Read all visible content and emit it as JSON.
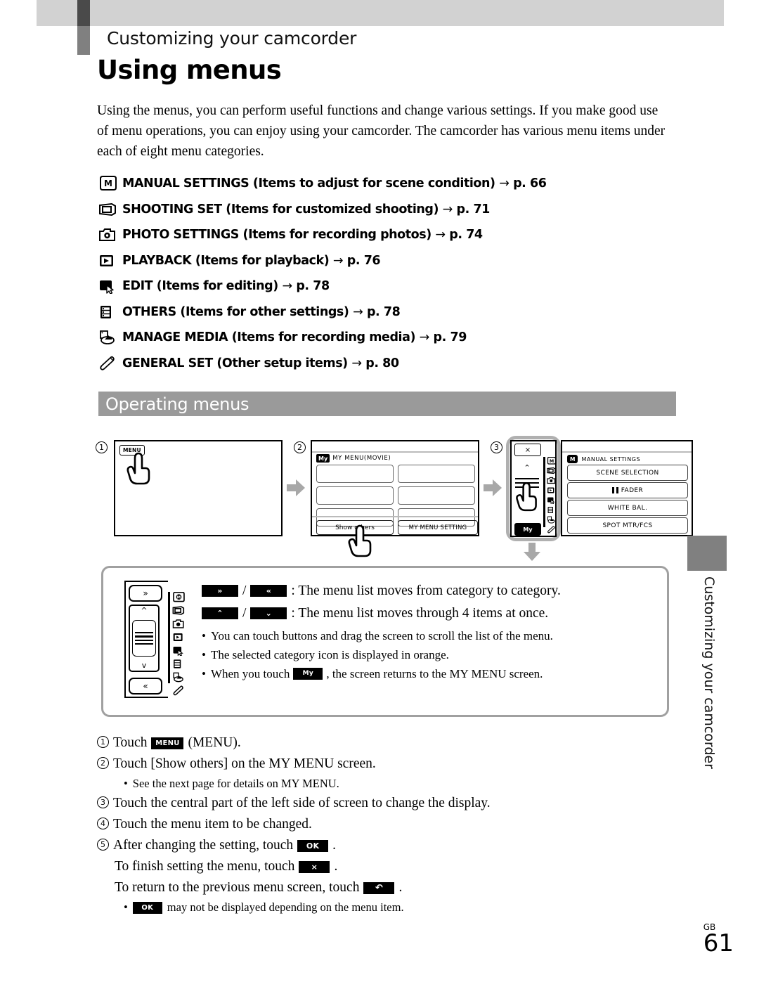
{
  "header": {
    "chapter": "Customizing your camcorder",
    "title": "Using menus"
  },
  "intro": "Using the menus, you can perform useful functions and change various settings. If you make good use of menu operations, you can enjoy using your camcorder. The camcorder has various menu items under each of eight menu categories.",
  "categories": [
    {
      "icon": "manual-settings-icon",
      "label": "MANUAL SETTINGS (Items to adjust for scene condition)",
      "arrow": "→",
      "page": "p. 66"
    },
    {
      "icon": "shooting-set-icon",
      "label": "SHOOTING SET (Items for customized shooting)",
      "arrow": "→",
      "page": "p. 71"
    },
    {
      "icon": "photo-settings-icon",
      "label": "PHOTO SETTINGS (Items for recording photos)",
      "arrow": "→",
      "page": "p. 74"
    },
    {
      "icon": "playback-icon",
      "label": "PLAYBACK (Items for playback)",
      "arrow": "→",
      "page": "p. 76"
    },
    {
      "icon": "edit-icon",
      "label": "EDIT (Items for editing)",
      "arrow": "→",
      "page": "p. 78"
    },
    {
      "icon": "others-icon",
      "label": "OTHERS (Items for other settings)",
      "arrow": "→",
      "page": "p. 78"
    },
    {
      "icon": "manage-media-icon",
      "label": "MANAGE MEDIA (Items for recording media)",
      "arrow": "→",
      "page": "p. 79"
    },
    {
      "icon": "general-set-icon",
      "label": "GENERAL SET (Other setup items)",
      "arrow": "→",
      "page": "p. 80"
    }
  ],
  "section": {
    "title": "Operating menus",
    "bar_color": "#9a9a9a"
  },
  "flow": {
    "step1": {
      "number": "1",
      "menu_button": "MENU"
    },
    "step2": {
      "number": "2",
      "badge": "My",
      "heading": "MY MENU(MOVIE)",
      "empty_slots": 6,
      "show_others": "Show others",
      "my_menu_setting": "MY MENU SETTING"
    },
    "step3": {
      "number": "3",
      "close_label": "×",
      "up_label": "⌃",
      "my_label": "My",
      "category_header_icon": "M",
      "category_header": "MANUAL SETTINGS",
      "items": [
        "SCENE SELECTION",
        "FADER",
        "WHITE BAL.",
        "SPOT MTR/FCS"
      ]
    }
  },
  "notes": {
    "line1_left": "»",
    "line1_right": "«",
    "line1_text": ": The menu list moves from category to category.",
    "line2_left": "⌃",
    "line2_right": "⌄",
    "line2_text": ": The menu list moves through 4 items at once.",
    "bullets": [
      "You can touch buttons and drag the screen to scroll the list of the menu.",
      "The selected category icon is displayed in orange."
    ],
    "bullet3_pre": "When you touch",
    "bullet3_key": "My",
    "bullet3_post": ", the screen returns to the MY MENU screen."
  },
  "steps": {
    "s1": {
      "num": "1",
      "pre": "Touch",
      "key": "MENU",
      "post": "(MENU)."
    },
    "s2": {
      "num": "2",
      "text": "Touch [Show others] on the MY MENU screen.",
      "sub": "See the next page for details on MY MENU."
    },
    "s3": {
      "num": "3",
      "text": "Touch the central part of the left side of screen to change the display."
    },
    "s4": {
      "num": "4",
      "text": "Touch the menu item to be changed."
    },
    "s5": {
      "num": "5",
      "pre": "After changing the setting, touch",
      "key": "OK",
      "post": ".",
      "line2_pre": "To finish setting the menu, touch",
      "line2_key": "×",
      "line2_post": ".",
      "line3_pre": "To return to the previous menu screen, touch",
      "line3_key": "↶",
      "line3_post": ".",
      "sub_key": "OK",
      "sub_post": "may not be displayed depending on the menu item."
    }
  },
  "side": {
    "tab_text": "Customizing your camcorder"
  },
  "footer": {
    "region": "GB",
    "page_number": "61"
  }
}
